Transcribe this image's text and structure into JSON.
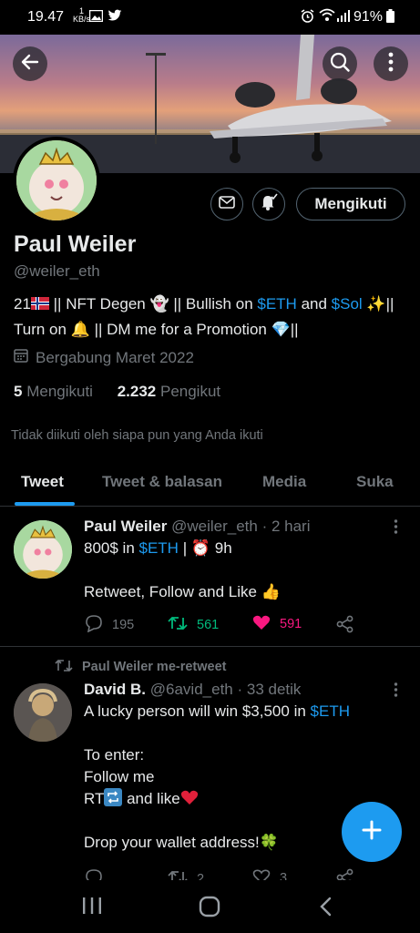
{
  "status_bar": {
    "time": "19.47",
    "net_speed": "1",
    "net_unit": "KB/s",
    "battery": "91%"
  },
  "header": {
    "back_icon": "back-arrow-icon",
    "search_icon": "search-icon",
    "more_icon": "more-vertical-icon"
  },
  "profile": {
    "name": "Paul Weiler",
    "handle": "@weiler_eth",
    "follow_button": "Mengikuti",
    "bio": {
      "l1_a": "21",
      "l1_b": " || NFT Degen ",
      "l1_c": " || Bullish on ",
      "l1_eth": "$ETH",
      "l1_and": " and ",
      "l1_sol": "$Sol",
      "l1_end": "||",
      "l2_a": "Turn on ",
      "l2_b": " || DM me for a Promotion ",
      "l2_end": "||"
    },
    "joined": "Bergabung Maret 2022",
    "following_count": "5",
    "following_label": "Mengikuti",
    "followers_count": "2.232",
    "followers_label": "Pengikut",
    "not_followed_text": "Tidak diikuti oleh siapa pun yang Anda ikuti"
  },
  "tabs": [
    {
      "label": "Tweet",
      "active": true
    },
    {
      "label": "Tweet & balasan",
      "active": false
    },
    {
      "label": "Media",
      "active": false
    },
    {
      "label": "Suka",
      "active": false
    }
  ],
  "tweet1": {
    "name": "Paul Weiler",
    "handle": "@weiler_eth",
    "time": "· 2 hari",
    "line1_a": "800$ in ",
    "line1_eth": "$ETH",
    "line1_b": " | ",
    "line1_c": " 9h",
    "line2": "Retweet, Follow and Like ",
    "replies": "195",
    "retweets": "561",
    "likes": "591"
  },
  "tweet2": {
    "retweet_label": "Paul Weiler me-retweet",
    "name": "David B.",
    "handle": "@6avid_eth",
    "time": "· 33 detik",
    "line1_a": "A lucky person will win $3,500 in ",
    "line1_eth": "$ETH",
    "line2": "To enter:",
    "line3": "Follow me",
    "line4_a": "RT",
    "line4_b": " and like",
    "line5": "Drop your wallet address!",
    "retweets": "2",
    "likes": "3"
  },
  "colors": {
    "accent": "#1d9bf0",
    "retweet_green": "#00ba7c",
    "like_pink": "#f91880",
    "text_grey": "#71767b"
  }
}
